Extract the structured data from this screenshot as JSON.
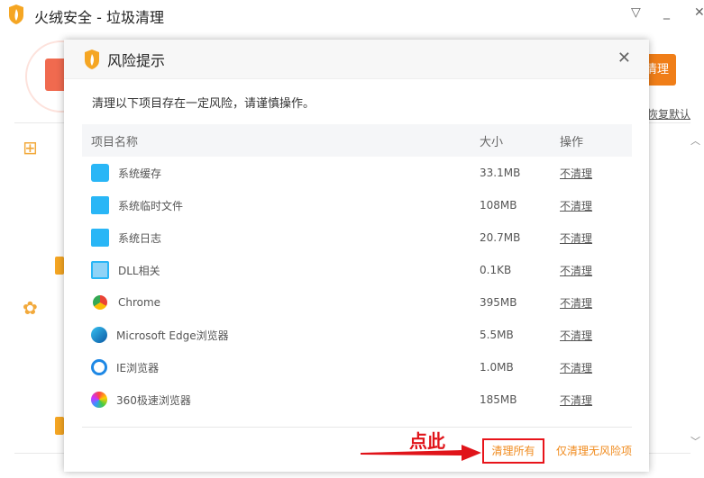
{
  "window": {
    "title": "火绒安全 - 垃圾清理",
    "controls": [
      "▽",
      "_",
      "✕"
    ]
  },
  "background": {
    "clean_button": "清理",
    "restore_default": "恢复默认"
  },
  "dialog": {
    "title": "风险提示",
    "warning": "清理以下项目存在一定风险，请谨慎操作。",
    "columns": [
      "项目名称",
      "大小",
      "操作"
    ],
    "rows": [
      {
        "name": "系统缓存",
        "size": "33.1MB",
        "action": "不清理",
        "icon": "drive-icon"
      },
      {
        "name": "系统临时文件",
        "size": "108MB",
        "action": "不清理",
        "icon": "folder-icon"
      },
      {
        "name": "系统日志",
        "size": "20.7MB",
        "action": "不清理",
        "icon": "log-icon"
      },
      {
        "name": "DLL相关",
        "size": "0.1KB",
        "action": "不清理",
        "icon": "dll-icon"
      },
      {
        "name": "Chrome",
        "size": "395MB",
        "action": "不清理",
        "icon": "chrome-icon"
      },
      {
        "name": "Microsoft Edge浏览器",
        "size": "5.5MB",
        "action": "不清理",
        "icon": "edge-icon"
      },
      {
        "name": "IE浏览器",
        "size": "1.0MB",
        "action": "不清理",
        "icon": "ie-icon"
      },
      {
        "name": "360极速浏览器",
        "size": "185MB",
        "action": "不清理",
        "icon": "360-browser-icon"
      }
    ],
    "clean_all": "清理所有",
    "clean_safe_only": "仅清理无风险项"
  },
  "annotation": {
    "text": "点此",
    "color": "#e0141a"
  },
  "colors": {
    "accent": "#f07e18",
    "link": "#f08a1c"
  }
}
